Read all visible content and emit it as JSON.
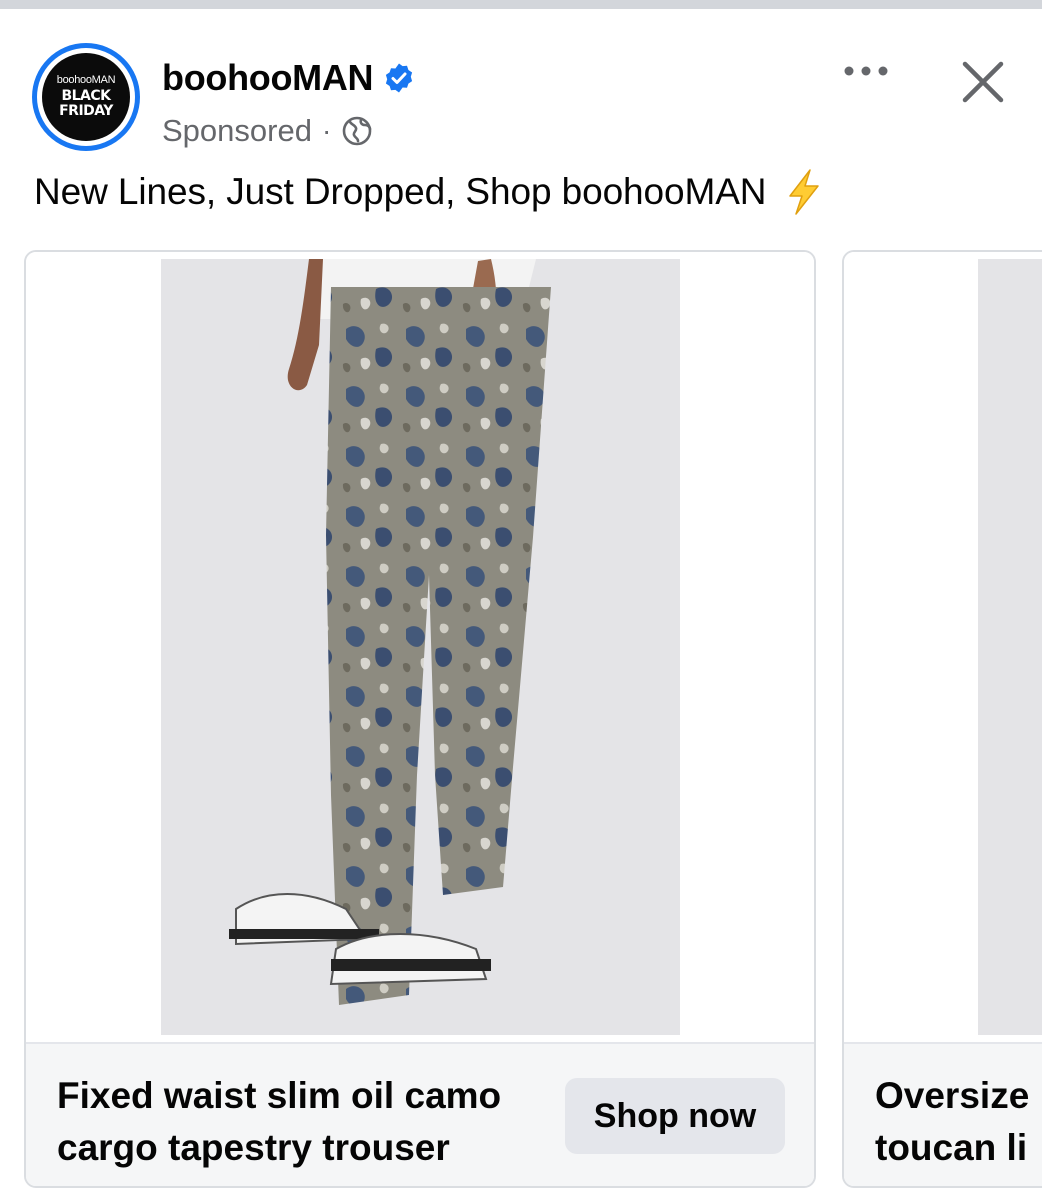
{
  "post": {
    "page_name": "boohooMAN",
    "sponsored_label": "Sponsored",
    "separator": "·",
    "caption": "New Lines, Just Dropped, Shop boohooMAN",
    "avatar": {
      "brand_text": "boohooMAN",
      "badge_text_line1": "BLACK",
      "badge_text_line2": "FRIDAY"
    },
    "icons": {
      "verified": "verified-badge-icon",
      "audience": "globe-icon",
      "more": "more-options-icon",
      "close": "close-icon",
      "caption_emoji": "lightning-bolt-icon"
    }
  },
  "carousel": {
    "cards": [
      {
        "title": "Fixed waist slim oil camo cargo tapestry trouser",
        "cta": "Shop now"
      },
      {
        "title": "Oversize toucan li",
        "title_line1": "Oversize",
        "title_line2": "toucan li"
      }
    ]
  },
  "colors": {
    "verified_blue": "#1877f2",
    "secondary_text": "#65676b",
    "card_footer_bg": "#f5f6f7",
    "button_bg": "#e4e6eb"
  }
}
